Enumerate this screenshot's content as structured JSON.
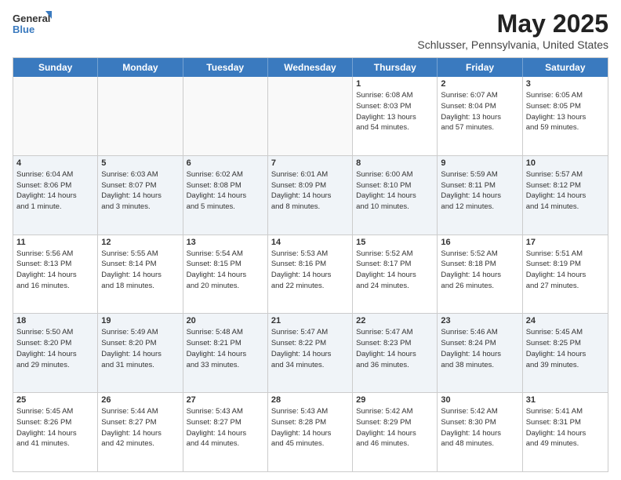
{
  "logo": {
    "text_general": "General",
    "text_blue": "Blue"
  },
  "title": "May 2025",
  "subtitle": "Schlusser, Pennsylvania, United States",
  "header_days": [
    "Sunday",
    "Monday",
    "Tuesday",
    "Wednesday",
    "Thursday",
    "Friday",
    "Saturday"
  ],
  "weeks": [
    [
      {
        "day": "",
        "info": "",
        "empty": true
      },
      {
        "day": "",
        "info": "",
        "empty": true
      },
      {
        "day": "",
        "info": "",
        "empty": true
      },
      {
        "day": "",
        "info": "",
        "empty": true
      },
      {
        "day": "1",
        "info": "Sunrise: 6:08 AM\nSunset: 8:03 PM\nDaylight: 13 hours\nand 54 minutes."
      },
      {
        "day": "2",
        "info": "Sunrise: 6:07 AM\nSunset: 8:04 PM\nDaylight: 13 hours\nand 57 minutes."
      },
      {
        "day": "3",
        "info": "Sunrise: 6:05 AM\nSunset: 8:05 PM\nDaylight: 13 hours\nand 59 minutes."
      }
    ],
    [
      {
        "day": "4",
        "info": "Sunrise: 6:04 AM\nSunset: 8:06 PM\nDaylight: 14 hours\nand 1 minute."
      },
      {
        "day": "5",
        "info": "Sunrise: 6:03 AM\nSunset: 8:07 PM\nDaylight: 14 hours\nand 3 minutes."
      },
      {
        "day": "6",
        "info": "Sunrise: 6:02 AM\nSunset: 8:08 PM\nDaylight: 14 hours\nand 5 minutes."
      },
      {
        "day": "7",
        "info": "Sunrise: 6:01 AM\nSunset: 8:09 PM\nDaylight: 14 hours\nand 8 minutes."
      },
      {
        "day": "8",
        "info": "Sunrise: 6:00 AM\nSunset: 8:10 PM\nDaylight: 14 hours\nand 10 minutes."
      },
      {
        "day": "9",
        "info": "Sunrise: 5:59 AM\nSunset: 8:11 PM\nDaylight: 14 hours\nand 12 minutes."
      },
      {
        "day": "10",
        "info": "Sunrise: 5:57 AM\nSunset: 8:12 PM\nDaylight: 14 hours\nand 14 minutes."
      }
    ],
    [
      {
        "day": "11",
        "info": "Sunrise: 5:56 AM\nSunset: 8:13 PM\nDaylight: 14 hours\nand 16 minutes."
      },
      {
        "day": "12",
        "info": "Sunrise: 5:55 AM\nSunset: 8:14 PM\nDaylight: 14 hours\nand 18 minutes."
      },
      {
        "day": "13",
        "info": "Sunrise: 5:54 AM\nSunset: 8:15 PM\nDaylight: 14 hours\nand 20 minutes."
      },
      {
        "day": "14",
        "info": "Sunrise: 5:53 AM\nSunset: 8:16 PM\nDaylight: 14 hours\nand 22 minutes."
      },
      {
        "day": "15",
        "info": "Sunrise: 5:52 AM\nSunset: 8:17 PM\nDaylight: 14 hours\nand 24 minutes."
      },
      {
        "day": "16",
        "info": "Sunrise: 5:52 AM\nSunset: 8:18 PM\nDaylight: 14 hours\nand 26 minutes."
      },
      {
        "day": "17",
        "info": "Sunrise: 5:51 AM\nSunset: 8:19 PM\nDaylight: 14 hours\nand 27 minutes."
      }
    ],
    [
      {
        "day": "18",
        "info": "Sunrise: 5:50 AM\nSunset: 8:20 PM\nDaylight: 14 hours\nand 29 minutes."
      },
      {
        "day": "19",
        "info": "Sunrise: 5:49 AM\nSunset: 8:20 PM\nDaylight: 14 hours\nand 31 minutes."
      },
      {
        "day": "20",
        "info": "Sunrise: 5:48 AM\nSunset: 8:21 PM\nDaylight: 14 hours\nand 33 minutes."
      },
      {
        "day": "21",
        "info": "Sunrise: 5:47 AM\nSunset: 8:22 PM\nDaylight: 14 hours\nand 34 minutes."
      },
      {
        "day": "22",
        "info": "Sunrise: 5:47 AM\nSunset: 8:23 PM\nDaylight: 14 hours\nand 36 minutes."
      },
      {
        "day": "23",
        "info": "Sunrise: 5:46 AM\nSunset: 8:24 PM\nDaylight: 14 hours\nand 38 minutes."
      },
      {
        "day": "24",
        "info": "Sunrise: 5:45 AM\nSunset: 8:25 PM\nDaylight: 14 hours\nand 39 minutes."
      }
    ],
    [
      {
        "day": "25",
        "info": "Sunrise: 5:45 AM\nSunset: 8:26 PM\nDaylight: 14 hours\nand 41 minutes."
      },
      {
        "day": "26",
        "info": "Sunrise: 5:44 AM\nSunset: 8:27 PM\nDaylight: 14 hours\nand 42 minutes."
      },
      {
        "day": "27",
        "info": "Sunrise: 5:43 AM\nSunset: 8:27 PM\nDaylight: 14 hours\nand 44 minutes."
      },
      {
        "day": "28",
        "info": "Sunrise: 5:43 AM\nSunset: 8:28 PM\nDaylight: 14 hours\nand 45 minutes."
      },
      {
        "day": "29",
        "info": "Sunrise: 5:42 AM\nSunset: 8:29 PM\nDaylight: 14 hours\nand 46 minutes."
      },
      {
        "day": "30",
        "info": "Sunrise: 5:42 AM\nSunset: 8:30 PM\nDaylight: 14 hours\nand 48 minutes."
      },
      {
        "day": "31",
        "info": "Sunrise: 5:41 AM\nSunset: 8:31 PM\nDaylight: 14 hours\nand 49 minutes."
      }
    ]
  ],
  "accent_color": "#3a7abf"
}
